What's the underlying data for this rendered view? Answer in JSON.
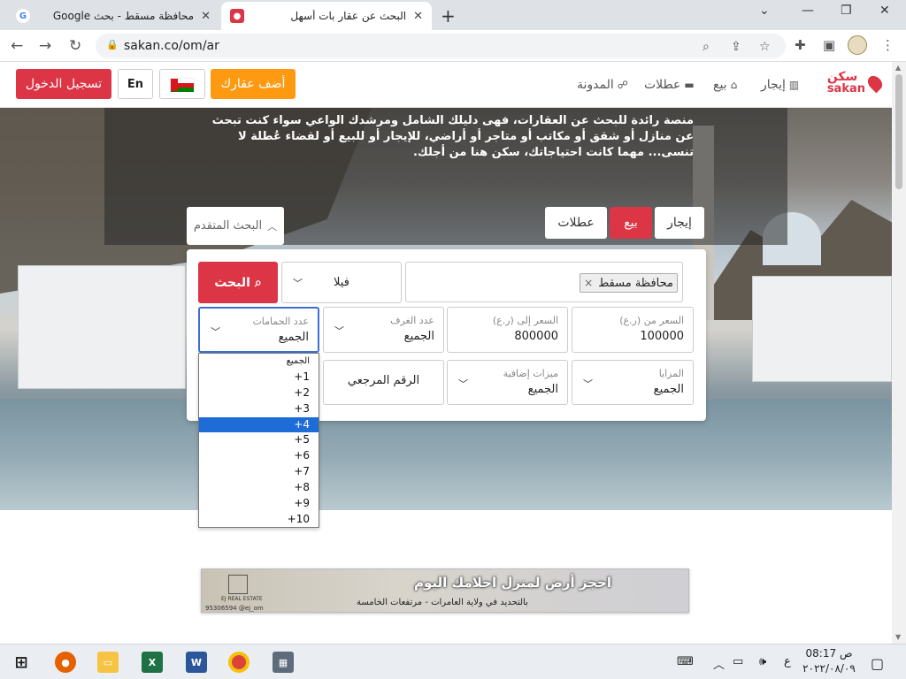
{
  "browser": {
    "tabs": [
      {
        "title": "محافظة مسقط - بحث Google",
        "active": false,
        "favicon": "google-icon"
      },
      {
        "title": "البحث عن عقار بات أسهل",
        "active": true,
        "favicon": "sakan-pin-icon"
      }
    ],
    "url": "sakan.co/om/ar"
  },
  "site": {
    "logo_ar": "سكن",
    "logo_en": "sakan",
    "nav": [
      {
        "label": "إيجار",
        "icon": "building-icon"
      },
      {
        "label": "بيع",
        "icon": "home-icon"
      },
      {
        "label": "عطلات",
        "icon": "bed-icon"
      },
      {
        "label": "المدونة",
        "icon": "blog-icon"
      }
    ],
    "add_property": "أضف عقارك",
    "lang": "En",
    "login": "تسجيل الدخول",
    "brand_color": "#dc3545",
    "accent_color": "#fd9a12"
  },
  "hero": {
    "intro": "منصة رائدة للبحث عن العقارات، فهى دليلك الشامل ومرشدك الواعي سواء كنت تبحث عن منازل أو شقق أو مكاتب أو متاجر أو أراضي، للإيجار أو للبيع أو لقضاء عُطلة لا تنسى... مهما كانت احتياجاتك، سكن هنا من أجلك."
  },
  "search": {
    "advanced": "البحث المتقدم",
    "tabs": [
      {
        "label": "إيجار",
        "active": false
      },
      {
        "label": "بيع",
        "active": true
      },
      {
        "label": "عطلات",
        "active": false
      }
    ],
    "location_chip": "محافظة مسقط",
    "location_remove": "×",
    "type_value": "فيلا",
    "search_button": "البحث",
    "price_from": {
      "label": "السعر من (ر.ع)",
      "value": "100000"
    },
    "price_to": {
      "label": "السعر إلى (ر.ع)",
      "value": "800000"
    },
    "rooms": {
      "label": "عدد الغرف",
      "value": "الجميع"
    },
    "baths": {
      "label": "عدد الحمامات",
      "value": "الجميع"
    },
    "features": {
      "label": "المزايا",
      "value": "الجميع"
    },
    "extras": {
      "label": "ميزات إضافية",
      "value": "الجميع"
    },
    "ref_placeholder": "الرقم المرجعي",
    "bath_options": [
      "الجميع",
      "1+",
      "2+",
      "3+",
      "4+",
      "5+",
      "6+",
      "7+",
      "8+",
      "9+",
      "10+"
    ],
    "bath_highlighted_index": 4
  },
  "banner": {
    "heading": "احجز أرض لمنزل احلامك اليوم",
    "sub": "بالتحديد في ولاية العامرات - مرتفعات الخامسة",
    "logo_text": "EJ REAL ESTATE",
    "social": "95306594 @ej_om"
  },
  "taskbar": {
    "lang": "ع",
    "time": "08:17 ص",
    "date": "٢٠٢٢/٠٨/٠٩"
  }
}
